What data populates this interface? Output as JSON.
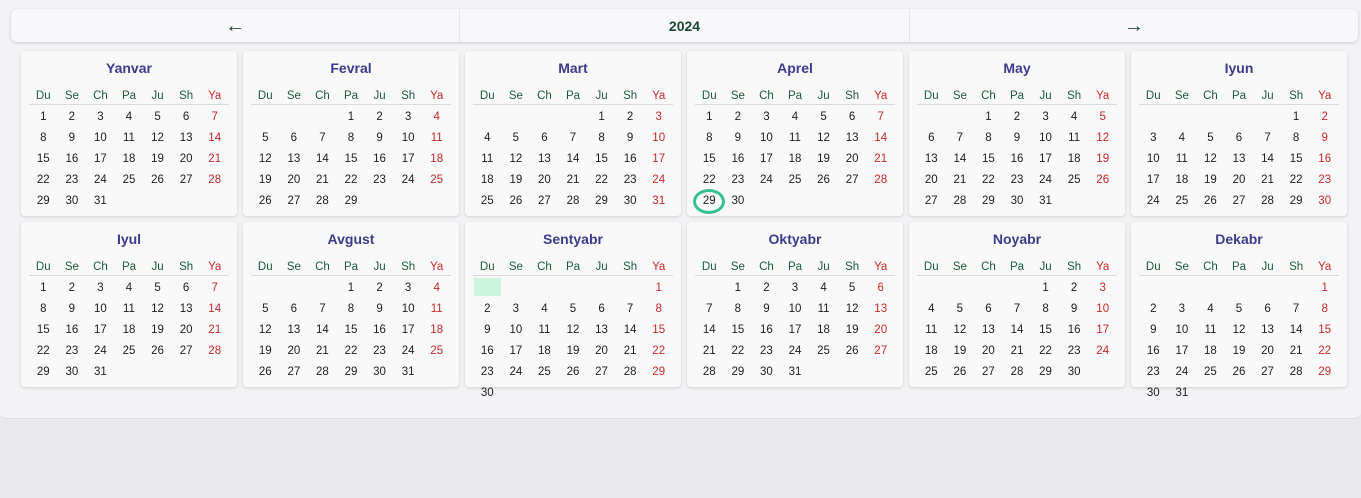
{
  "nav": {
    "prev_label": "←",
    "year": "2024",
    "next_label": "→"
  },
  "weekdays": [
    "Du",
    "Se",
    "Ch",
    "Pa",
    "Ju",
    "Sh",
    "Ya"
  ],
  "today": {
    "month_index": 3,
    "day": 29
  },
  "highlight": {
    "month_index": 8,
    "cell": 0
  },
  "colors": {
    "weekend": "#c62828",
    "month_title": "#3d3a8c",
    "today_ring": "#34c190",
    "highlight": "#ccf5dc"
  },
  "months": [
    {
      "name": "Yanvar",
      "offset": 0,
      "days": 31
    },
    {
      "name": "Fevral",
      "offset": 3,
      "days": 29
    },
    {
      "name": "Mart",
      "offset": 4,
      "days": 31
    },
    {
      "name": "Aprel",
      "offset": 0,
      "days": 30
    },
    {
      "name": "May",
      "offset": 2,
      "days": 31
    },
    {
      "name": "Iyun",
      "offset": 5,
      "days": 30
    },
    {
      "name": "Iyul",
      "offset": 0,
      "days": 31
    },
    {
      "name": "Avgust",
      "offset": 3,
      "days": 31
    },
    {
      "name": "Sentyabr",
      "offset": 6,
      "days": 30
    },
    {
      "name": "Oktyabr",
      "offset": 1,
      "days": 31
    },
    {
      "name": "Noyabr",
      "offset": 4,
      "days": 30
    },
    {
      "name": "Dekabr",
      "offset": 6,
      "days": 31
    }
  ]
}
